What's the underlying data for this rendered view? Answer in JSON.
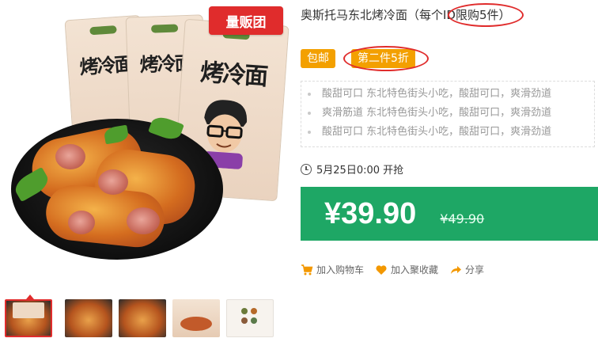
{
  "gallery": {
    "badge": "量贩团",
    "pack_text": "烤冷面",
    "thumbnails": [
      {
        "name": "packs-and-food",
        "active": true
      },
      {
        "name": "food-plate",
        "active": false
      },
      {
        "name": "food-closeup",
        "active": false
      },
      {
        "name": "packs",
        "active": false
      },
      {
        "name": "ingredients",
        "active": false
      }
    ]
  },
  "product": {
    "title": "奥斯托马东北烤冷面（每个ID限购5件）",
    "tags": {
      "free_shipping": "包邮",
      "discount": "第二件5折"
    },
    "features": [
      "酸甜可口 东北特色街头小吃，酸甜可口，爽滑劲道",
      "爽滑筋道 东北特色街头小吃，酸甜可口，爽滑劲道",
      "酸甜可口 东北特色街头小吃，酸甜可口，爽滑劲道"
    ],
    "sale_time": "5月25日0:00 开抢",
    "price": "¥39.90",
    "original_price": "¥49.90"
  },
  "actions": {
    "add_to_cart": "加入购物车",
    "favorite": "加入聚收藏",
    "share": "分享"
  },
  "colors": {
    "accent_red": "#e02c2c",
    "tag_orange": "#f3a000",
    "price_green": "#1ea765"
  }
}
